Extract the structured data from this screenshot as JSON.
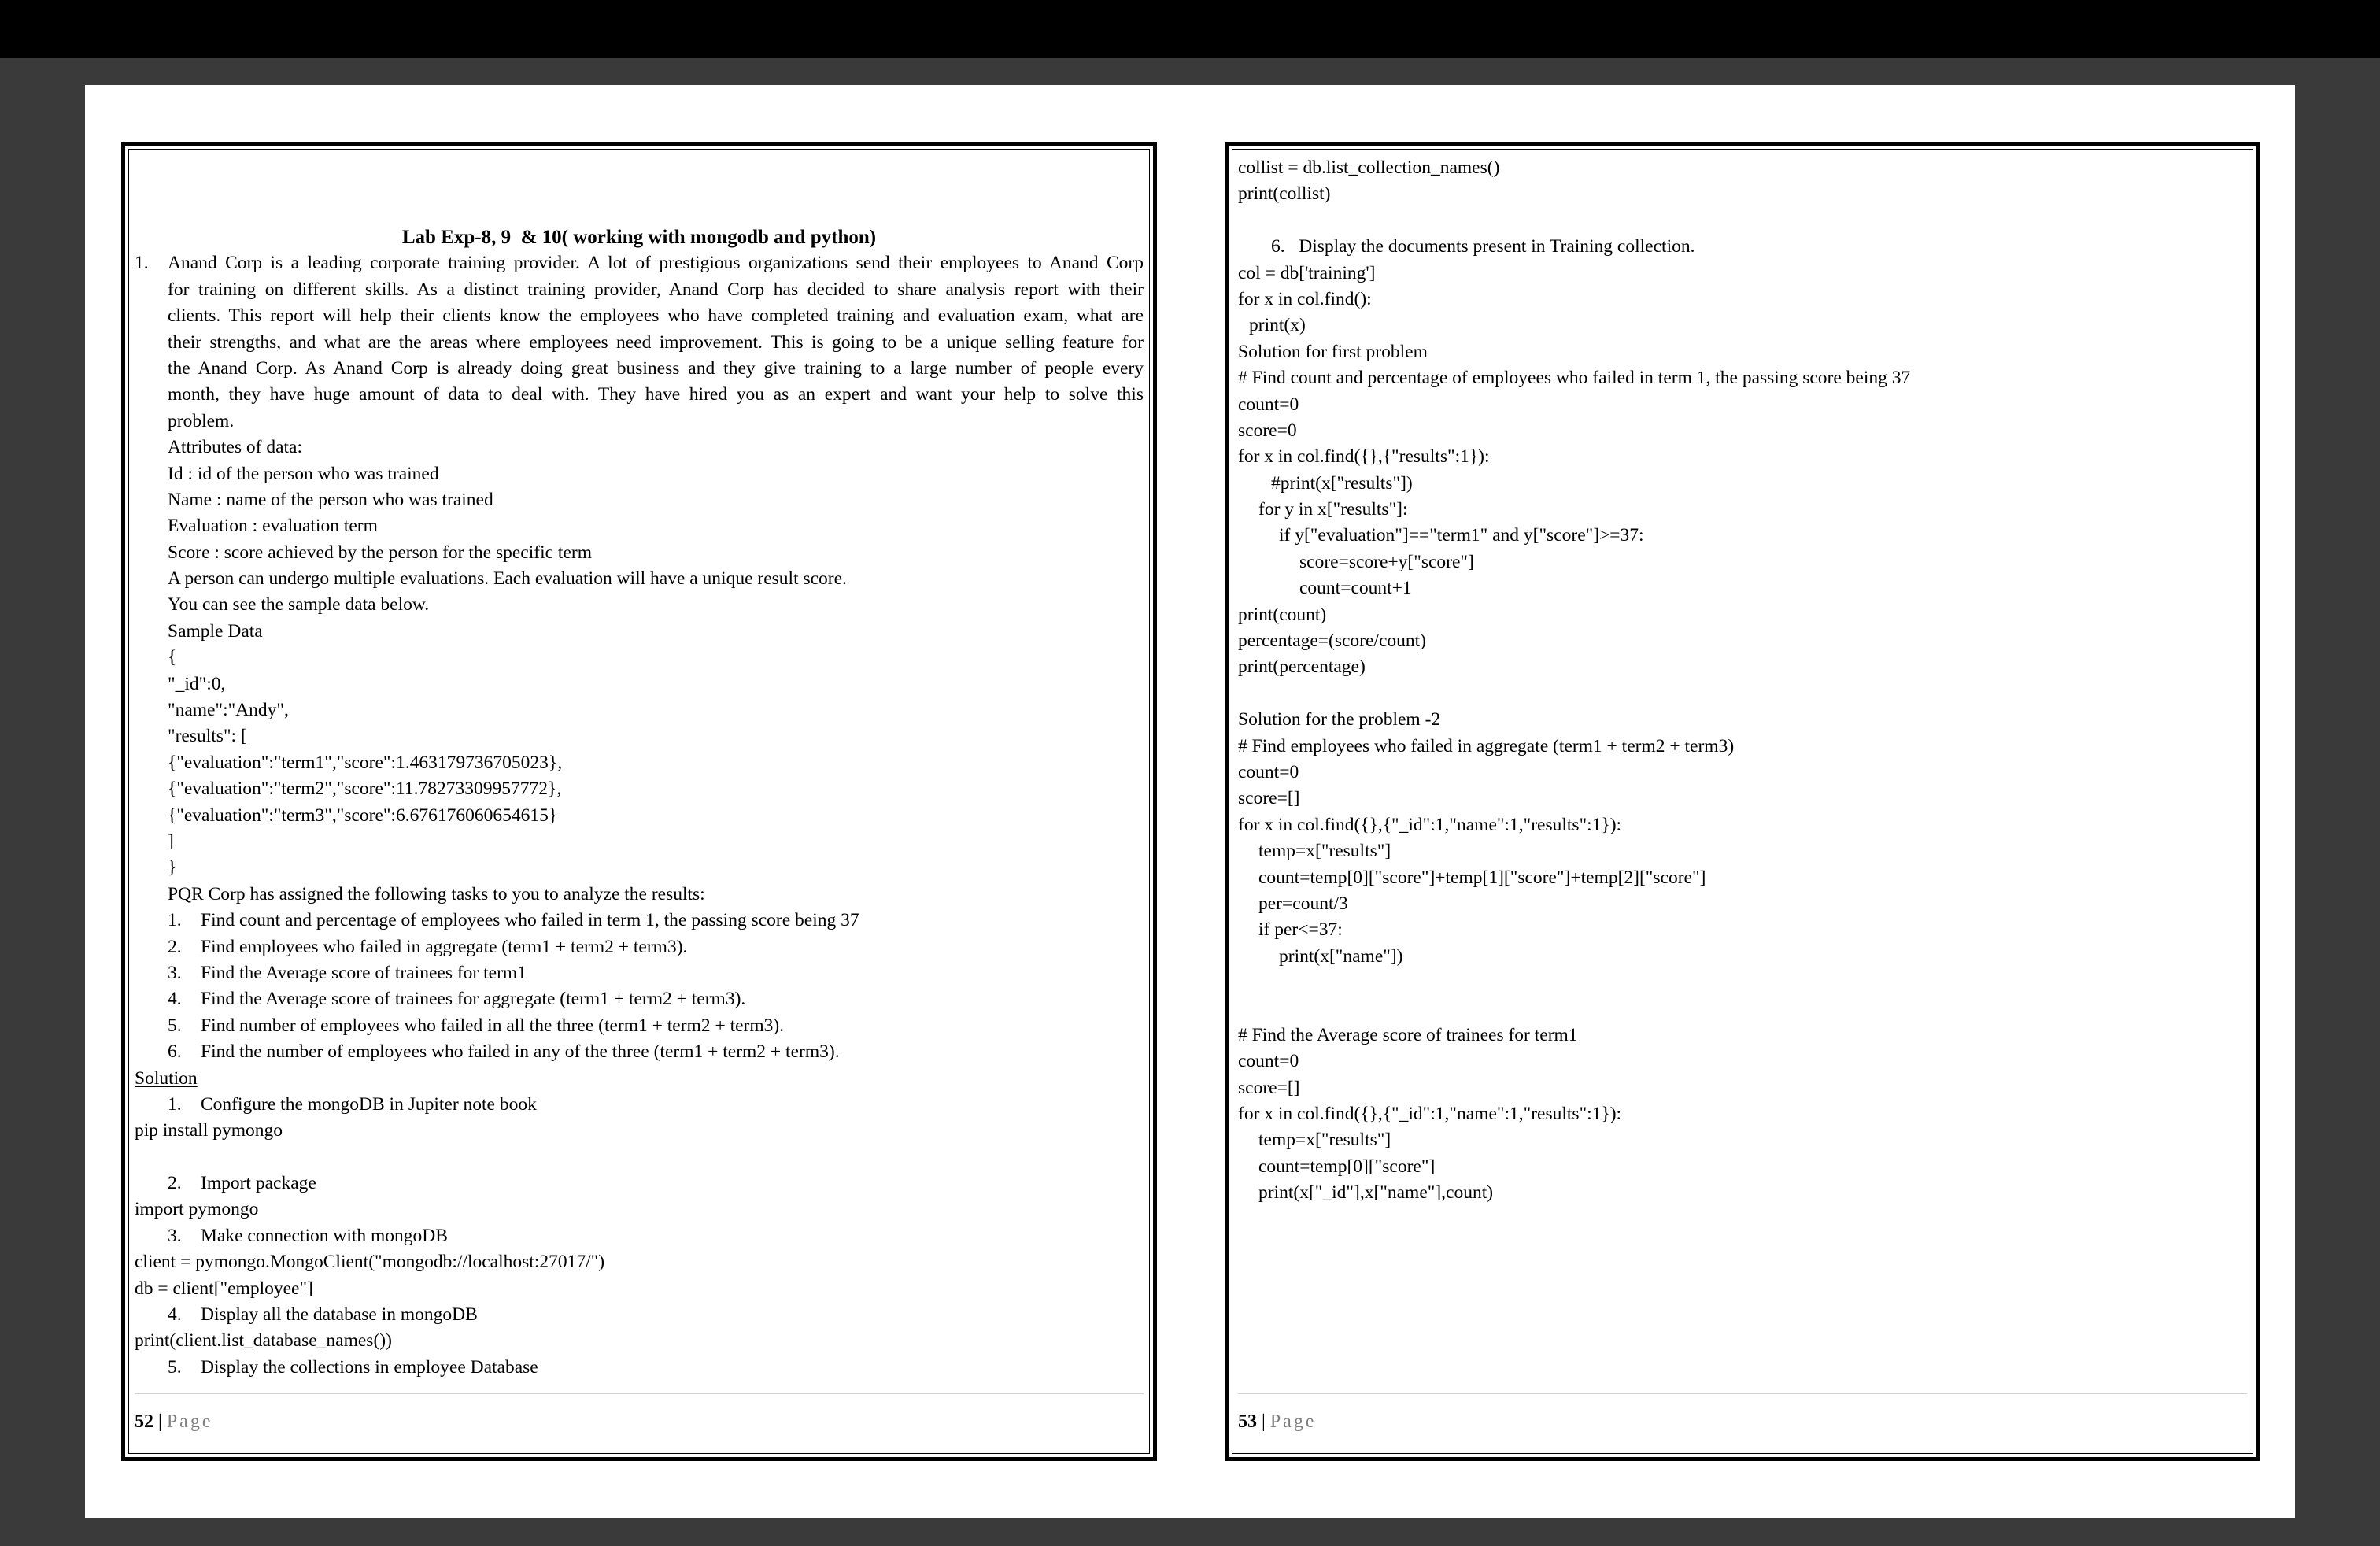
{
  "left_page": {
    "title": "Lab Exp-8, 9  & 10( working with mongodb and python)",
    "intro_number": "1.",
    "intro_lines": [
      "Anand Corp is a leading corporate training provider. A lot of prestigious organizations send their employees to Anand Corp",
      "for training on different skills. As a distinct training provider, Anand Corp has decided to share analysis report with their",
      "clients. This report will help their clients know the employees who have completed training and evaluation exam, what are",
      "their strengths, and what are the areas where employees need improvement. This is going to be a unique selling feature for",
      "the Anand Corp. As Anand Corp is already doing great business and they give training to a large number of people every",
      "month, they have huge amount of data to deal with. They have hired you as an expert and want your help to solve this"
    ],
    "intro_last": "problem.",
    "attr_lines": [
      "Attributes of data:",
      "Id : id of the person who was trained",
      "Name : name of the person who was trained",
      "Evaluation : evaluation term",
      "Score : score achieved by the person for the specific term",
      "A person can undergo multiple evaluations. Each evaluation will have a unique result score.",
      "You can see the sample data below.",
      "Sample Data",
      "{",
      "\"_id\":0,",
      "\"name\":\"Andy\",",
      "\"results\": [",
      "{\"evaluation\":\"term1\",\"score\":1.463179736705023},",
      "{\"evaluation\":\"term2\",\"score\":11.78273309957772},",
      "{\"evaluation\":\"term3\",\"score\":6.676176060654615}",
      "]",
      "}",
      "PQR Corp has assigned the following tasks to you to analyze the results:"
    ],
    "tasks": [
      {
        "num": "1.",
        "text": "Find count and percentage of employees who failed in term 1, the passing score being 37"
      },
      {
        "num": "2.",
        "text": "Find employees who failed in aggregate (term1 + term2 + term3)."
      },
      {
        "num": "3.",
        "text": "Find the Average score of trainees for term1"
      },
      {
        "num": "4.",
        "text": "Find the Average score of trainees for aggregate (term1 + term2 + term3)."
      },
      {
        "num": "5.",
        "text": "Find number of employees who failed in all the three (term1 + term2 + term3)."
      },
      {
        "num": "6.",
        "text": "Find the number of employees who failed in any of the three (term1 + term2 + term3)."
      }
    ],
    "solution_heading": "Solution",
    "steps": {
      "s1_num": "1.",
      "s1_text": "Configure the mongoDB in Jupiter note book",
      "s1_code": "pip install pymongo",
      "s2_num": "2.",
      "s2_text": "Import package",
      "s2_code": "import pymongo",
      "s3_num": "3.",
      "s3_text": "Make connection with mongoDB",
      "s3_code1": "client = pymongo.MongoClient(\"mongodb://localhost:27017/\")",
      "s3_code2": "db = client[\"employee\"]",
      "s4_num": "4.",
      "s4_text": "Display all the database in mongoDB",
      "s4_code": "print(client.list_database_names())",
      "s5_num": "5.",
      "s5_text": "Display the collections in employee Database"
    },
    "page_number": "52",
    "page_sep": "|",
    "page_label": "Page"
  },
  "right_page": {
    "lines": [
      {
        "text": "collist = db.list_collection_names()",
        "indent": 0
      },
      {
        "text": "print(collist)",
        "indent": 0
      },
      {
        "text": "",
        "indent": 0
      },
      {
        "text": "6.   Display the documents present in Training collection.",
        "indent": 2
      },
      {
        "text": "col = db['training']",
        "indent": 0
      },
      {
        "text": "for x in col.find():",
        "indent": 0
      },
      {
        "text": "print(x)",
        "indent": 1
      },
      {
        "text": "Solution for first problem",
        "indent": 0
      },
      {
        "text": "# Find count and percentage of employees who failed in term 1, the passing score being 37",
        "indent": 0
      },
      {
        "text": "count=0",
        "indent": 0
      },
      {
        "text": "score=0",
        "indent": 0
      },
      {
        "text": "for x in col.find({},{\"results\":1}):",
        "indent": 0
      },
      {
        "text": "#print(x[\"results\"])",
        "indent": 2
      },
      {
        "text": "for y in x[\"results\"]:",
        "indent": 3
      },
      {
        "text": "if y[\"evaluation\"]==\"term1\" and y[\"score\"]>=37:",
        "indent": 4
      },
      {
        "text": "score=score+y[\"score\"]",
        "indent": 5
      },
      {
        "text": "count=count+1",
        "indent": 5
      },
      {
        "text": "print(count)",
        "indent": 0
      },
      {
        "text": "percentage=(score/count)",
        "indent": 0
      },
      {
        "text": "print(percentage)",
        "indent": 0
      },
      {
        "text": "",
        "indent": 0
      },
      {
        "text": "Solution for the problem -2",
        "indent": 0
      },
      {
        "text": "# Find employees who failed in aggregate (term1 + term2 + term3)",
        "indent": 0
      },
      {
        "text": "count=0",
        "indent": 0
      },
      {
        "text": "score=[]",
        "indent": 0
      },
      {
        "text": "for x in col.find({},{\"_id\":1,\"name\":1,\"results\":1}):",
        "indent": 0
      },
      {
        "text": "temp=x[\"results\"]",
        "indent": 3
      },
      {
        "text": "count=temp[0][\"score\"]+temp[1][\"score\"]+temp[2][\"score\"]",
        "indent": 3
      },
      {
        "text": "per=count/3",
        "indent": 3
      },
      {
        "text": "if per<=37:",
        "indent": 3
      },
      {
        "text": "print(x[\"name\"])",
        "indent": 4
      },
      {
        "text": "",
        "indent": 0
      },
      {
        "text": "",
        "indent": 0
      },
      {
        "text": "# Find the Average score of trainees for term1",
        "indent": 0
      },
      {
        "text": "count=0",
        "indent": 0
      },
      {
        "text": "score=[]",
        "indent": 0
      },
      {
        "text": "for x in col.find({},{\"_id\":1,\"name\":1,\"results\":1}):",
        "indent": 0
      },
      {
        "text": "temp=x[\"results\"]",
        "indent": 3
      },
      {
        "text": "count=temp[0][\"score\"]",
        "indent": 3
      },
      {
        "text": "print(x[\"_id\"],x[\"name\"],count)",
        "indent": 3
      }
    ],
    "page_number": "53",
    "page_sep": "|",
    "page_label": "Page"
  }
}
